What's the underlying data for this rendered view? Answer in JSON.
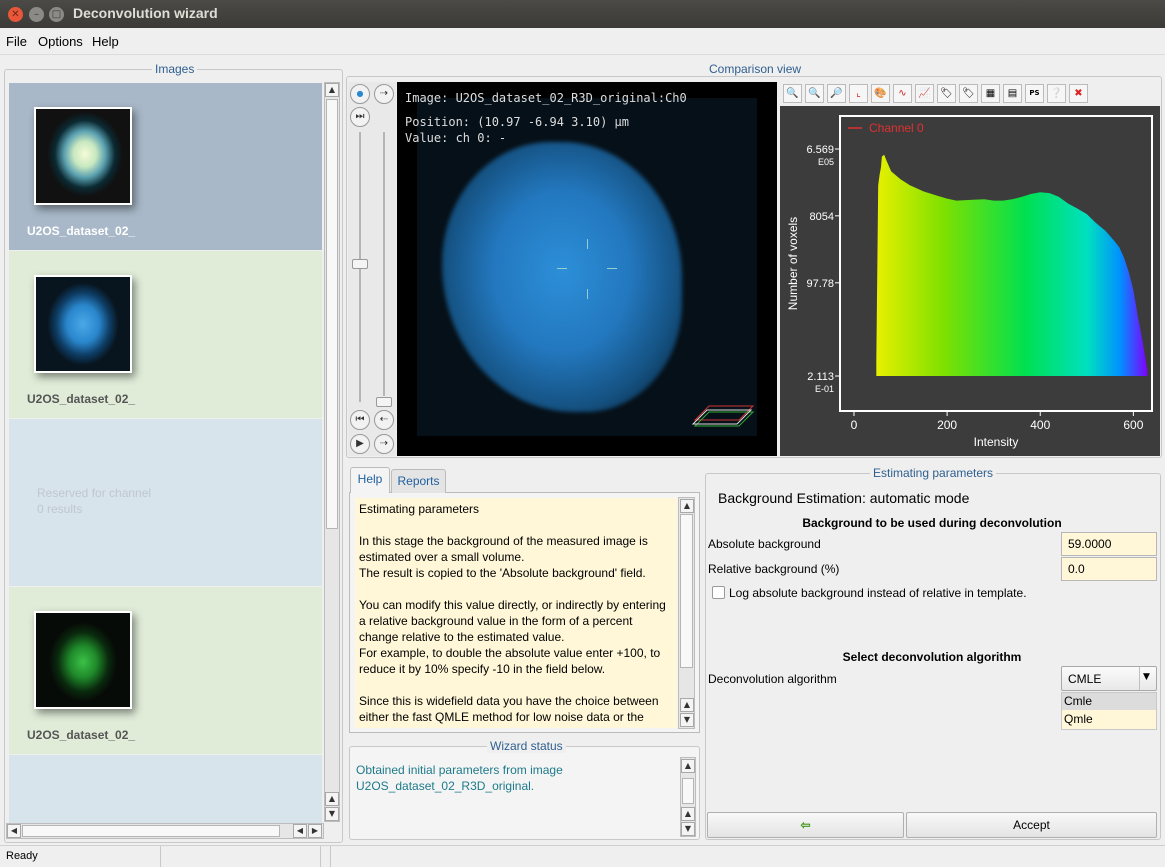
{
  "window": {
    "title": "Deconvolution wizard"
  },
  "menu": [
    {
      "label": "File"
    },
    {
      "label": "Options"
    },
    {
      "label": "Help"
    }
  ],
  "images_panel": {
    "label": "Images",
    "items": [
      {
        "name": "U2OS_dataset_02_",
        "kind": "raw-bright"
      },
      {
        "name": "U2OS_dataset_02_",
        "kind": "blue"
      },
      {
        "name": "Reserved for channel 0 results",
        "kind": "reserved"
      },
      {
        "name": "U2OS_dataset_02_",
        "kind": "green"
      }
    ]
  },
  "comparison": {
    "label": "Comparison view",
    "viewer": {
      "image_line": "Image: U2OS_dataset_02_R3D_original:Ch0",
      "position_line": "Position: (10.97 -6.94 3.10) µm",
      "value_line": "Value: ch 0: -"
    },
    "toolbar_icons": [
      "zoom-in-icon",
      "zoom-out-icon",
      "zoom-fit-icon",
      "axes-icon",
      "palette-icon",
      "curve-icon",
      "chart-icon",
      "tag-icon",
      "label-icon",
      "table-icon",
      "export-icon",
      "ps-icon",
      "help-icon",
      "close-icon"
    ],
    "ps_label": "PS"
  },
  "chart_data": {
    "type": "area",
    "title": "",
    "legend": [
      "Channel 0"
    ],
    "legend_color": "#e03030",
    "legend_placement": "top-left",
    "xlabel": "Intensity",
    "ylabel": "Number of voxels",
    "yscale": "log",
    "xlim": [
      -30,
      640
    ],
    "x_ticks": [
      0,
      200,
      400,
      600
    ],
    "y_ticks": [
      {
        "label": "6.569",
        "exp": "E05",
        "value": 656900
      },
      {
        "label": "8054",
        "exp": "",
        "value": 8054
      },
      {
        "label": "97.78",
        "exp": "",
        "value": 97.78
      },
      {
        "label": "2.113",
        "exp": "E-01",
        "value": 0.2113
      }
    ],
    "series": [
      {
        "x": [
          48,
          52,
          55,
          58,
          60,
          65,
          70,
          80,
          100,
          120,
          150,
          180,
          200,
          220,
          250,
          280,
          300,
          320,
          340,
          360,
          380,
          400,
          420,
          440,
          460,
          480,
          500,
          520,
          540,
          560,
          570,
          580,
          590,
          600,
          610,
          620,
          630
        ],
        "y": [
          0.5,
          60000,
          120000,
          200000,
          400000,
          450000,
          300000,
          150000,
          90000,
          60000,
          40000,
          30000,
          25000,
          22000,
          23000,
          24000,
          22000,
          22000,
          24000,
          28000,
          34000,
          38000,
          36000,
          28000,
          18000,
          13000,
          9000,
          5000,
          3000,
          1500,
          1000,
          500,
          200,
          60,
          10,
          2,
          0.3
        ]
      }
    ]
  },
  "help": {
    "tabs": [
      {
        "label": "Help"
      },
      {
        "label": "Reports"
      }
    ],
    "paragraphs": [
      "Estimating parameters",
      "In this stage the background of the measured image is estimated over a small volume.\nThe result is copied to the 'Absolute background' field.",
      "You can modify this value directly, or indirectly by entering a relative background value in the form of a percent change relative to the estimated value.\nFor example, to double the absolute value enter +100, to reduce it by 10% specify -10 in the field below.",
      "Since this is widefield data you have the choice between either the fast QMLE method for low noise data or the"
    ]
  },
  "wizard_status": {
    "label": "Wizard status",
    "text": "Obtained initial parameters from image U2OS_dataset_02_R3D_original."
  },
  "estimating": {
    "label": "Estimating parameters",
    "heading": "Background Estimation: automatic mode",
    "bg_section": "Background to be used during deconvolution",
    "abs_label": "Absolute background",
    "abs_value": "59.0000",
    "rel_label": "Relative background (%)",
    "rel_value": "0.0",
    "log_label": "Log absolute background instead of relative in template.",
    "algo_section": "Select deconvolution algorithm",
    "algo_label": "Deconvolution algorithm",
    "algo_value": "CMLE",
    "algo_options": [
      "Cmle",
      "Qmle"
    ],
    "back_icon": "back-arrow-icon",
    "accept_label": "Accept"
  },
  "statusbar": {
    "text": "Ready"
  }
}
